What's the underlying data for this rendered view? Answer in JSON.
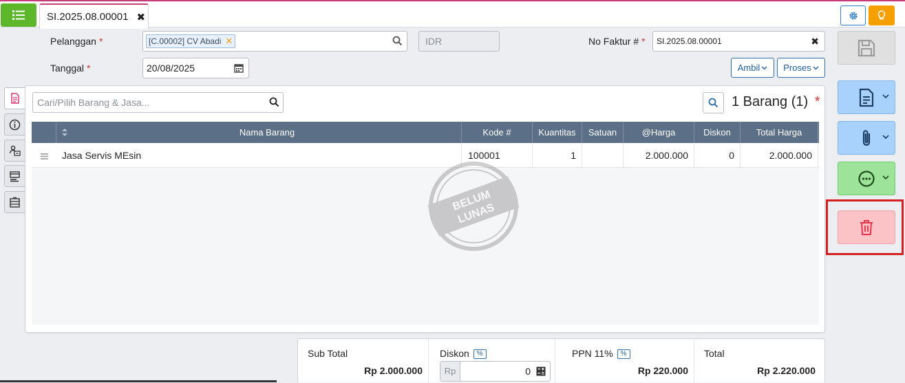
{
  "tabs": {
    "active_label": "SI.2025.08.00001"
  },
  "form": {
    "pelanggan_label": "Pelanggan",
    "customer_tag": "[C.00002] CV Abadi",
    "currency": "IDR",
    "faktur_label": "No Faktur #",
    "faktur_value": "SI.2025.08.00001",
    "tanggal_label": "Tanggal",
    "tanggal_value": "20/08/2025",
    "ambil_label": "Ambil",
    "proses_label": "Proses",
    "required_mark": "*"
  },
  "items": {
    "search_placeholder": "Cari/Pilih Barang & Jasa...",
    "count_label": "1 Barang (1)",
    "columns": [
      "Nama Barang",
      "Kode #",
      "Kuantitas",
      "Satuan",
      "@Harga",
      "Diskon",
      "Total Harga"
    ],
    "rows": [
      {
        "nama": "Jasa Servis MEsin",
        "kode": "100001",
        "qty": "1",
        "satuan": "",
        "harga": "2.000.000",
        "diskon": "0",
        "total": "2.000.000"
      }
    ],
    "stamp_line1": "BELUM",
    "stamp_line2": "LUNAS"
  },
  "summary": {
    "subtotal_label": "Sub Total",
    "subtotal_value": "Rp 2.000.000",
    "diskon_label": "Diskon",
    "pct_label": "%",
    "diskon_currency": "Rp",
    "diskon_value": "0",
    "ppn_label": "PPN 11%",
    "ppn_value": "Rp 220.000",
    "total_label": "Total",
    "total_value": "Rp 2.220.000"
  },
  "colors": {
    "accent": "#c93a7a",
    "menu_green": "#5cb82a",
    "header_slate": "#5b6f86",
    "delete_red": "#e8334a",
    "highlight": "#d62020"
  }
}
